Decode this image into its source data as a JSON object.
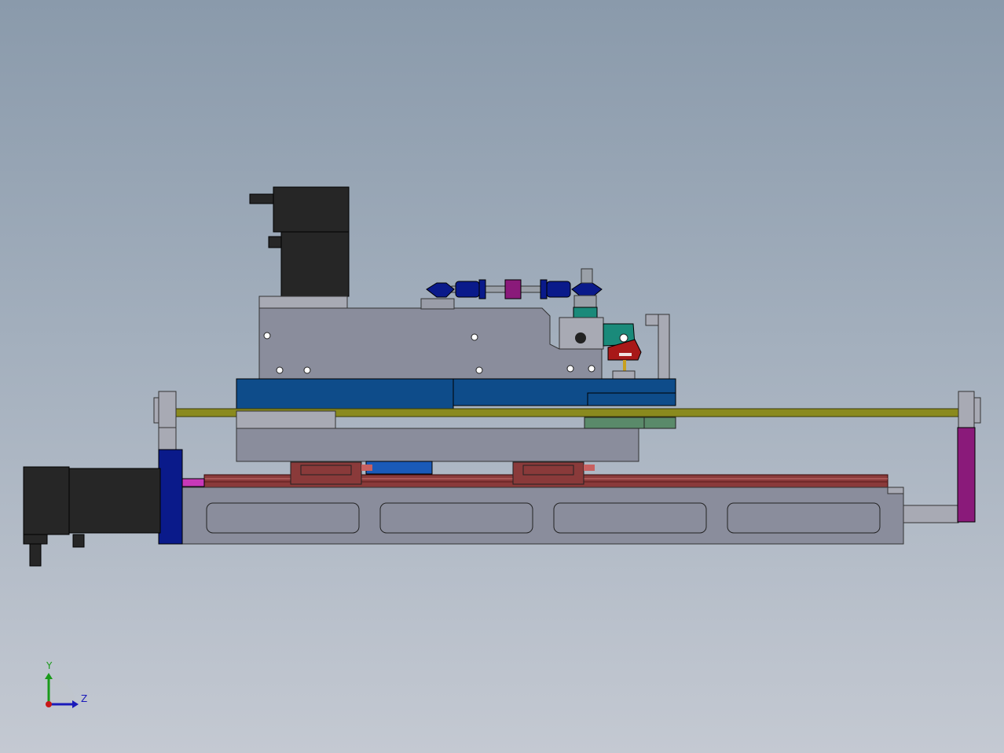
{
  "viewport": {
    "background_top": "#8a9aab",
    "background_bottom": "#c4c9d2"
  },
  "colors": {
    "motor_black": "#262626",
    "steel_gray": "#8a8d9c",
    "light_gray": "#a8aab4",
    "blue_plate": "#0e4c8a",
    "navy": "#0a1a8a",
    "rod_olive": "#8a8a1e",
    "rail_brown": "#8a3a3a",
    "magenta": "#8a1a7a",
    "teal": "#1a8a7a",
    "red": "#a81818",
    "sage_green": "#5a8a6a",
    "bright_blue": "#1a5ab8"
  },
  "triad": {
    "y_label": "Y",
    "z_label": "Z",
    "y_color": "#1a9a1a",
    "z_color": "#1a1aba",
    "x_color": "#c81818"
  }
}
